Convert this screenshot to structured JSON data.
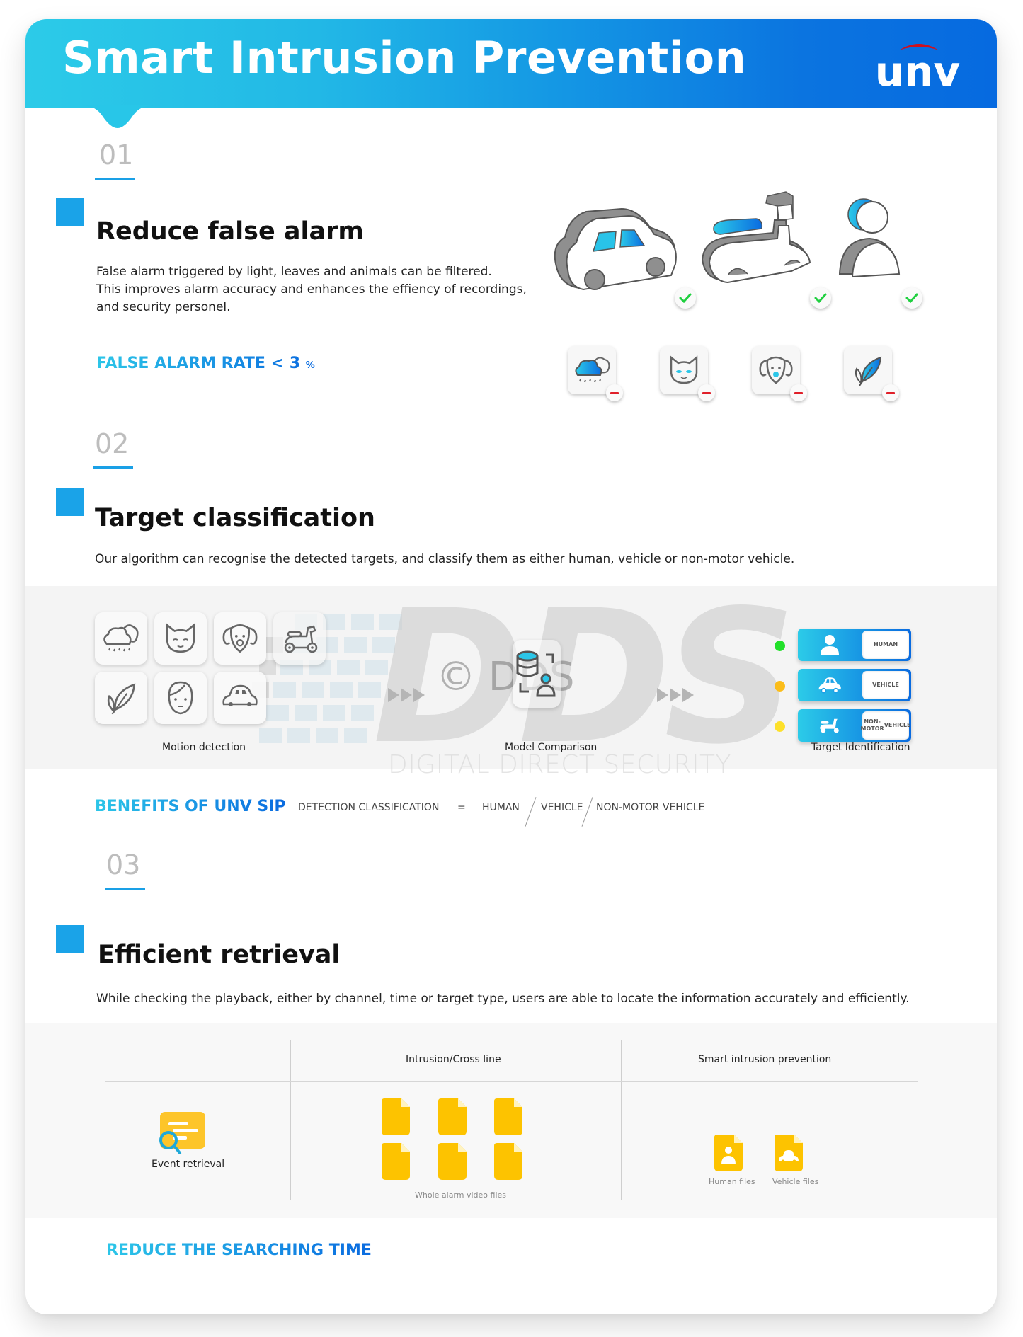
{
  "header": {
    "title": "Smart Intrusion Prevention",
    "logo_text": "unv",
    "gradient_start": "#2ccbe8",
    "gradient_end": "#066ae0",
    "logo_arc_color": "#d0101c"
  },
  "sections": [
    {
      "number": "01",
      "heading": "Reduce false alarm",
      "body_lines": [
        "False alarm triggered by light, leaves and animals can be filtered.",
        "This improves alarm accuracy and enhances the effiency of recordings,",
        "and security personel."
      ],
      "highlight": {
        "label": "FALSE ALARM RATE",
        "operator": "<",
        "value": "3",
        "unit": "%"
      },
      "accepted_targets": [
        {
          "icon": "car-icon",
          "status": "check-icon"
        },
        {
          "icon": "scooter-icon",
          "status": "check-icon"
        },
        {
          "icon": "person-icon",
          "status": "check-icon"
        }
      ],
      "filtered_sources": [
        {
          "icon": "rain-cloud-icon",
          "status": "minus-icon"
        },
        {
          "icon": "cat-icon",
          "status": "minus-icon"
        },
        {
          "icon": "dog-icon",
          "status": "minus-icon"
        },
        {
          "icon": "leaf-icon",
          "status": "minus-icon"
        }
      ]
    },
    {
      "number": "02",
      "heading": "Target classification",
      "body": "Our algorithm can recognise the detected targets, and classify them as either human, vehicle or non-motor vehicle.",
      "flow": {
        "motion_detection_label": "Motion detection",
        "motion_icons": [
          "rain-cloud-icon",
          "cat-icon",
          "dog-icon",
          "scooter-icon",
          "leaf-icon",
          "woman-face-icon",
          "car-icon"
        ],
        "model_comparison_label": "Model Comparison",
        "target_identification_label": "Target Identification",
        "targets": [
          {
            "label": "HUMAN",
            "icon": "person-icon",
            "dot_color": "#22e02a"
          },
          {
            "label": "VEHICLE",
            "icon": "car-icon",
            "dot_color": "#fbbd1a"
          },
          {
            "label": "NON-MOTOR VEHICLE",
            "label_lines": [
              "NON-MOTOR",
              "VEHICLE"
            ],
            "icon": "scooter-icon",
            "dot_color": "#fde02a"
          }
        ]
      },
      "watermark": {
        "big": "DDS",
        "copyright": "© DDS",
        "subtitle": "DIGITAL DIRECT SECURITY"
      },
      "benefits": {
        "title": "BENEFITS OF UNV SIP",
        "left": "DETECTION CLASSIFICATION",
        "equals": "=",
        "items": [
          "HUMAN",
          "VEHICLE",
          "NON-MOTOR VEHICLE"
        ]
      }
    },
    {
      "number": "03",
      "heading": "Efficient retrieval",
      "body": "While checking the playback, either by channel, time or target type, users are able to locate the information accurately and efficiently.",
      "table": {
        "row_label": "Event retrieval",
        "col_intrusion": "Intrusion/Cross line",
        "col_smart": "Smart intrusion prevention",
        "intrusion_caption": "Whole alarm video files",
        "intrusion_file_count": 6,
        "smart_files": [
          {
            "label": "Human files",
            "icon": "person-file-icon"
          },
          {
            "label": "Vehicle files",
            "icon": "car-file-icon"
          }
        ],
        "file_color": "#fdc300"
      },
      "highlight": "REDUCE THE SEARCHING TIME"
    }
  ],
  "colors": {
    "accent_blue": "#1aa3e8",
    "text_dark": "#111111",
    "numeral_gray": "#bdbdbd"
  }
}
